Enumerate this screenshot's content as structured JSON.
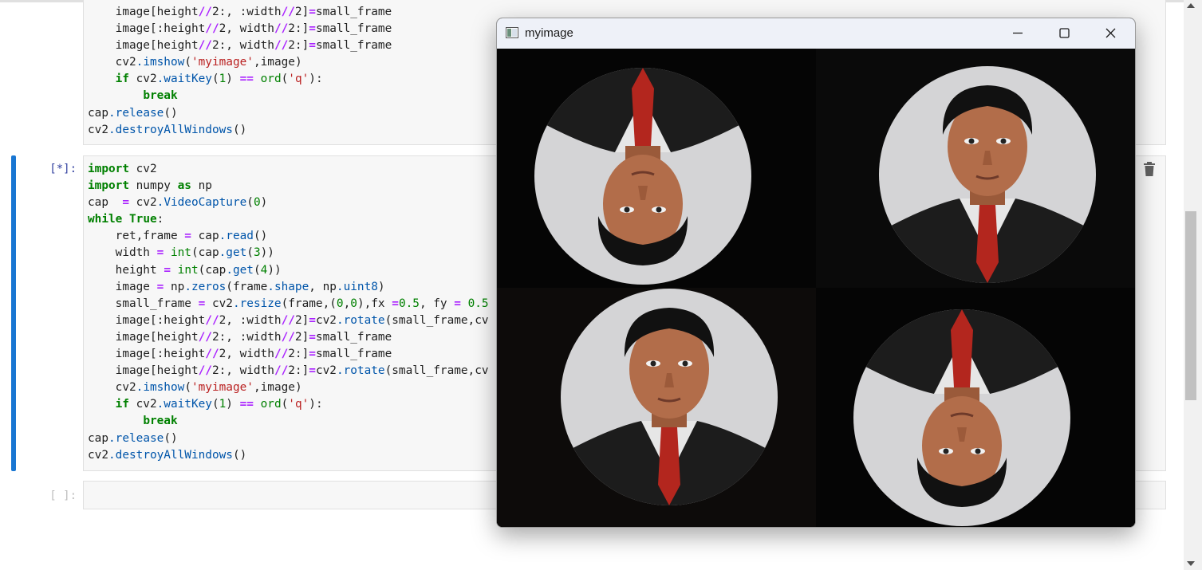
{
  "notebook": {
    "cells": [
      {
        "prompt": "",
        "lines": [
          [
            {
              "t": "    image[height"
            },
            {
              "t": "//",
              "c": "op"
            },
            {
              "t": "2:, :width"
            },
            {
              "t": "//",
              "c": "op"
            },
            {
              "t": "2]"
            },
            {
              "t": "=",
              "c": "op"
            },
            {
              "t": "small_frame"
            }
          ],
          [
            {
              "t": "    image[:height"
            },
            {
              "t": "//",
              "c": "op"
            },
            {
              "t": "2, width"
            },
            {
              "t": "//",
              "c": "op"
            },
            {
              "t": "2:]"
            },
            {
              "t": "=",
              "c": "op"
            },
            {
              "t": "small_frame"
            }
          ],
          [
            {
              "t": "    image[height"
            },
            {
              "t": "//",
              "c": "op"
            },
            {
              "t": "2:, width"
            },
            {
              "t": "//",
              "c": "op"
            },
            {
              "t": "2:]"
            },
            {
              "t": "=",
              "c": "op"
            },
            {
              "t": "small_frame"
            }
          ],
          [
            {
              "t": "    cv2"
            },
            {
              "t": ".imshow",
              "c": "fn"
            },
            {
              "t": "("
            },
            {
              "t": "'myimage'",
              "c": "str"
            },
            {
              "t": ",image)"
            }
          ],
          [
            {
              "t": "    "
            },
            {
              "t": "if",
              "c": "kw"
            },
            {
              "t": " cv2"
            },
            {
              "t": ".waitKey",
              "c": "fn"
            },
            {
              "t": "("
            },
            {
              "t": "1",
              "c": "num"
            },
            {
              "t": ") "
            },
            {
              "t": "==",
              "c": "op"
            },
            {
              "t": " "
            },
            {
              "t": "ord",
              "c": "num"
            },
            {
              "t": "("
            },
            {
              "t": "'q'",
              "c": "str"
            },
            {
              "t": "):"
            }
          ],
          [
            {
              "t": "        "
            },
            {
              "t": "break",
              "c": "kw"
            }
          ],
          [
            {
              "t": "cap"
            },
            {
              "t": ".release",
              "c": "fn"
            },
            {
              "t": "()"
            }
          ],
          [
            {
              "t": "cv2"
            },
            {
              "t": ".destroyAllWindows",
              "c": "fn"
            },
            {
              "t": "()"
            }
          ]
        ]
      },
      {
        "prompt": "[*]:",
        "lines": [
          [
            {
              "t": "import",
              "c": "kw"
            },
            {
              "t": " cv2"
            }
          ],
          [
            {
              "t": "import",
              "c": "kw"
            },
            {
              "t": " numpy "
            },
            {
              "t": "as",
              "c": "kw"
            },
            {
              "t": " np"
            }
          ],
          [
            {
              "t": "cap  "
            },
            {
              "t": "=",
              "c": "op"
            },
            {
              "t": " cv2"
            },
            {
              "t": ".VideoCapture",
              "c": "fn"
            },
            {
              "t": "("
            },
            {
              "t": "0",
              "c": "num"
            },
            {
              "t": ")"
            }
          ],
          [
            {
              "t": "while",
              "c": "kw"
            },
            {
              "t": " "
            },
            {
              "t": "True",
              "c": "kw"
            },
            {
              "t": ":"
            }
          ],
          [
            {
              "t": "    ret,frame "
            },
            {
              "t": "=",
              "c": "op"
            },
            {
              "t": " cap"
            },
            {
              "t": ".read",
              "c": "fn"
            },
            {
              "t": "()"
            }
          ],
          [
            {
              "t": "    width "
            },
            {
              "t": "=",
              "c": "op"
            },
            {
              "t": " "
            },
            {
              "t": "int",
              "c": "num"
            },
            {
              "t": "(cap"
            },
            {
              "t": ".get",
              "c": "fn"
            },
            {
              "t": "("
            },
            {
              "t": "3",
              "c": "num"
            },
            {
              "t": "))"
            }
          ],
          [
            {
              "t": "    height "
            },
            {
              "t": "=",
              "c": "op"
            },
            {
              "t": " "
            },
            {
              "t": "int",
              "c": "num"
            },
            {
              "t": "(cap"
            },
            {
              "t": ".get",
              "c": "fn"
            },
            {
              "t": "("
            },
            {
              "t": "4",
              "c": "num"
            },
            {
              "t": "))"
            }
          ],
          [
            {
              "t": "    image "
            },
            {
              "t": "=",
              "c": "op"
            },
            {
              "t": " np"
            },
            {
              "t": ".zeros",
              "c": "fn"
            },
            {
              "t": "(frame"
            },
            {
              "t": ".shape",
              "c": "fn"
            },
            {
              "t": ", np"
            },
            {
              "t": ".uint8",
              "c": "fn"
            },
            {
              "t": ")"
            }
          ],
          [
            {
              "t": "    small_frame "
            },
            {
              "t": "=",
              "c": "op"
            },
            {
              "t": " cv2"
            },
            {
              "t": ".resize",
              "c": "fn"
            },
            {
              "t": "(frame,("
            },
            {
              "t": "0",
              "c": "num"
            },
            {
              "t": ","
            },
            {
              "t": "0",
              "c": "num"
            },
            {
              "t": "),fx "
            },
            {
              "t": "=",
              "c": "op"
            },
            {
              "t": "0.5",
              "c": "num"
            },
            {
              "t": ", fy "
            },
            {
              "t": "=",
              "c": "op"
            },
            {
              "t": " "
            },
            {
              "t": "0.5",
              "c": "num"
            }
          ],
          [
            {
              "t": "    image[:height"
            },
            {
              "t": "//",
              "c": "op"
            },
            {
              "t": "2, :width"
            },
            {
              "t": "//",
              "c": "op"
            },
            {
              "t": "2]"
            },
            {
              "t": "=",
              "c": "op"
            },
            {
              "t": "cv2"
            },
            {
              "t": ".rotate",
              "c": "fn"
            },
            {
              "t": "(small_frame,cv"
            }
          ],
          [
            {
              "t": "    image[height"
            },
            {
              "t": "//",
              "c": "op"
            },
            {
              "t": "2:, :width"
            },
            {
              "t": "//",
              "c": "op"
            },
            {
              "t": "2]"
            },
            {
              "t": "=",
              "c": "op"
            },
            {
              "t": "small_frame"
            }
          ],
          [
            {
              "t": "    image[:height"
            },
            {
              "t": "//",
              "c": "op"
            },
            {
              "t": "2, width"
            },
            {
              "t": "//",
              "c": "op"
            },
            {
              "t": "2:]"
            },
            {
              "t": "=",
              "c": "op"
            },
            {
              "t": "small_frame"
            }
          ],
          [
            {
              "t": "    image[height"
            },
            {
              "t": "//",
              "c": "op"
            },
            {
              "t": "2:, width"
            },
            {
              "t": "//",
              "c": "op"
            },
            {
              "t": "2:]"
            },
            {
              "t": "=",
              "c": "op"
            },
            {
              "t": "cv2"
            },
            {
              "t": ".rotate",
              "c": "fn"
            },
            {
              "t": "(small_frame,cv"
            }
          ],
          [
            {
              "t": "    cv2"
            },
            {
              "t": ".imshow",
              "c": "fn"
            },
            {
              "t": "("
            },
            {
              "t": "'myimage'",
              "c": "str"
            },
            {
              "t": ",image)"
            }
          ],
          [
            {
              "t": "    "
            },
            {
              "t": "if",
              "c": "kw"
            },
            {
              "t": " cv2"
            },
            {
              "t": ".waitKey",
              "c": "fn"
            },
            {
              "t": "("
            },
            {
              "t": "1",
              "c": "num"
            },
            {
              "t": ") "
            },
            {
              "t": "==",
              "c": "op"
            },
            {
              "t": " "
            },
            {
              "t": "ord",
              "c": "num"
            },
            {
              "t": "("
            },
            {
              "t": "'q'",
              "c": "str"
            },
            {
              "t": "):"
            }
          ],
          [
            {
              "t": "        "
            },
            {
              "t": "break",
              "c": "kw"
            }
          ],
          [
            {
              "t": "cap"
            },
            {
              "t": ".release",
              "c": "fn"
            },
            {
              "t": "()"
            }
          ],
          [
            {
              "t": "cv2"
            },
            {
              "t": ".destroyAllWindows",
              "c": "fn"
            },
            {
              "t": "()"
            }
          ]
        ]
      },
      {
        "prompt": "[ ]:",
        "lines": []
      }
    ]
  },
  "window": {
    "title": "myimage",
    "icon": "app-window-icon",
    "controls": [
      "minimize-icon",
      "maximize-icon",
      "close-icon"
    ]
  },
  "colors": {
    "keyword": "#008000",
    "function": "#0055aa",
    "operator": "#aa22ff",
    "string": "#ba2121",
    "active_cell_bar": "#1976d2"
  }
}
